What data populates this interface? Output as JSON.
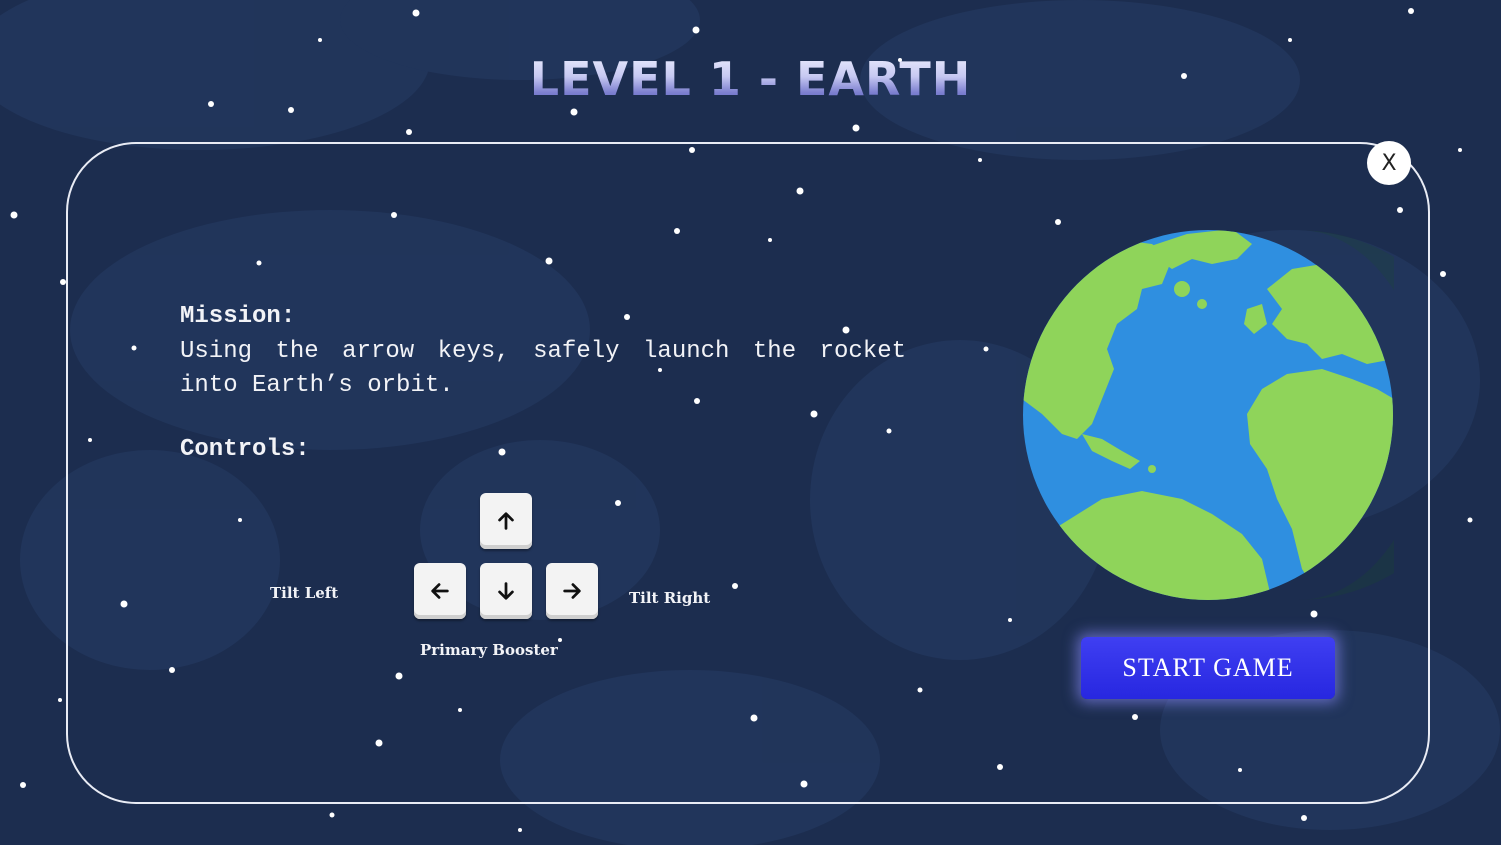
{
  "title": "LEVEL 1 - EARTH",
  "close_label": "X",
  "mission": {
    "heading": "Mission:",
    "text": "Using the arrow keys, safely launch the rocket into Earth’s orbit."
  },
  "controls": {
    "heading": "Controls:",
    "tilt_left": "Tilt Left",
    "tilt_right": "Tilt Right",
    "primary_booster": "Primary Booster",
    "keys": [
      "up-arrow-icon",
      "left-arrow-icon",
      "down-arrow-icon",
      "right-arrow-icon"
    ]
  },
  "start_button": "START GAME",
  "colors": {
    "background": "#1c2d4f",
    "ocean": "#2f8fe0",
    "land": "#8fd45a",
    "button": "#2f2fe8"
  }
}
